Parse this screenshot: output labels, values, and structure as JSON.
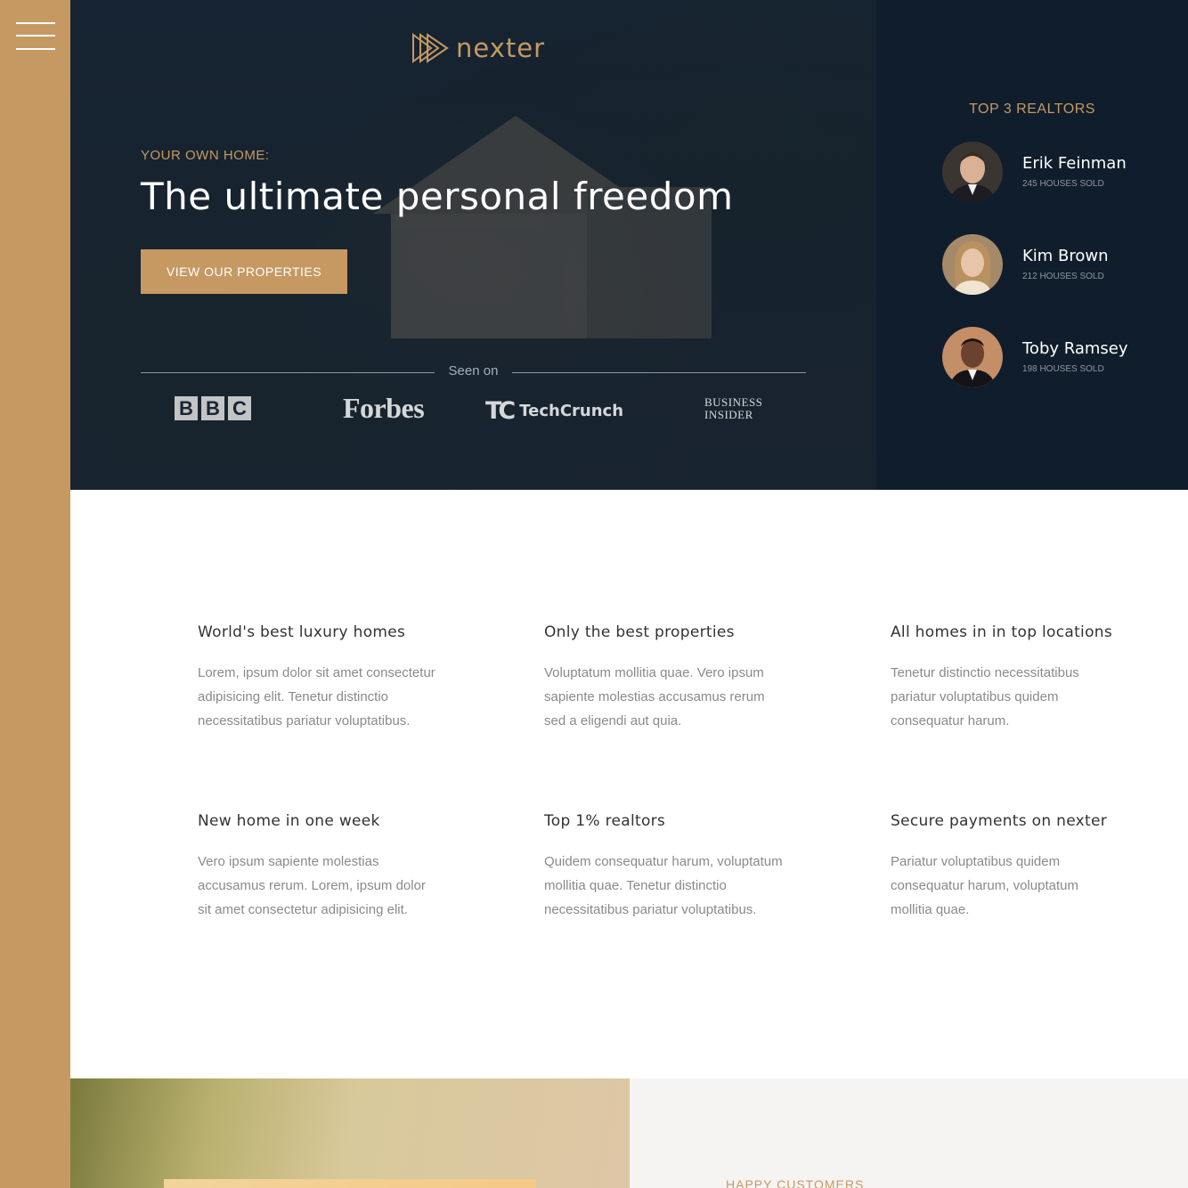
{
  "brand": {
    "name": "nexter",
    "accent_color": "#c69963",
    "dark_color": "#101d2c"
  },
  "sidebar": {
    "menu_icon": "hamburger-icon"
  },
  "hero": {
    "eyebrow": "YOUR OWN HOME:",
    "headline": "The ultimate personal freedom",
    "cta_label": "VIEW OUR PROPERTIES",
    "seen_on": "Seen on",
    "press_logos": {
      "bbc": [
        "B",
        "B",
        "C"
      ],
      "forbes": "Forbes",
      "techcrunch_mark": "TC",
      "techcrunch_word": "TechCrunch",
      "business_insider": "Business Insider"
    }
  },
  "realtors": {
    "title": "TOP 3 REALTORS",
    "items": [
      {
        "name": "Erik Feinman",
        "sold": "245 HOUSES SOLD"
      },
      {
        "name": "Kim Brown",
        "sold": "212 HOUSES SOLD"
      },
      {
        "name": "Toby Ramsey",
        "sold": "198 HOUSES SOLD"
      }
    ]
  },
  "features": [
    {
      "title": "World's best luxury homes",
      "text": "Lorem, ipsum dolor sit amet consectetur adipisicing elit. Tenetur distinctio necessitatibus pariatur voluptatibus."
    },
    {
      "title": "Only the best properties",
      "text": "Voluptatum mollitia quae. Vero ipsum sapiente molestias accusamus rerum sed a eligendi aut quia."
    },
    {
      "title": "All homes in in top locations",
      "text": "Tenetur distinctio necessitatibus pariatur voluptatibus quidem consequatur harum."
    },
    {
      "title": "New home in one week",
      "text": "Vero ipsum sapiente molestias accusamus rerum. Lorem, ipsum dolor sit amet consectetur adipisicing elit."
    },
    {
      "title": "Top 1% realtors",
      "text": "Quidem consequatur harum, voluptatum mollitia quae. Tenetur distinctio necessitatibus pariatur voluptatibus."
    },
    {
      "title": "Secure payments on nexter",
      "text": "Pariatur voluptatibus quidem consequatur harum, voluptatum mollitia quae."
    }
  ],
  "testimonials": {
    "title": "HAPPY CUSTOMERS"
  }
}
